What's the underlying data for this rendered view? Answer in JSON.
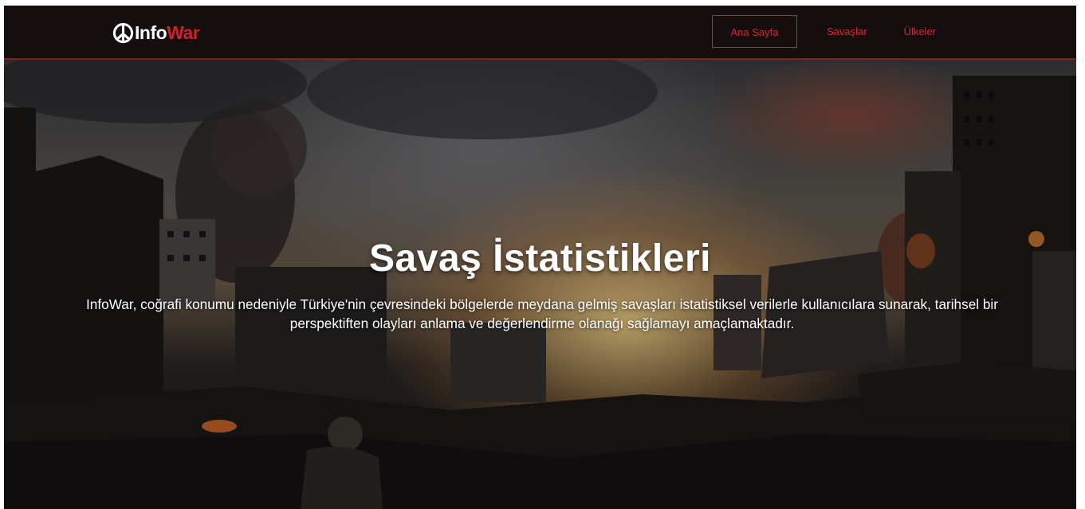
{
  "logo": {
    "icon": "peace-icon",
    "part1": "Info",
    "part2": "War"
  },
  "nav": {
    "items": [
      {
        "label": "Ana Sayfa",
        "active": true
      },
      {
        "label": "Savaşlar",
        "active": false
      },
      {
        "label": "Ülkeler",
        "active": false
      }
    ]
  },
  "hero": {
    "title": "Savaş İstatistikleri",
    "description": "InfoWar, coğrafi konumu nedeniyle Türkiye'nin çevresindeki bölgelerde meydana gelmiş savaşları istatistiksel verilerle kullanıcılara sunarak, tarihsel bir perspektiften olayları anlama ve değerlendirme olanağı sağlamayı amaçlamaktadır."
  },
  "colors": {
    "accent": "#d42026",
    "navbar_bg": "#140e0f"
  }
}
